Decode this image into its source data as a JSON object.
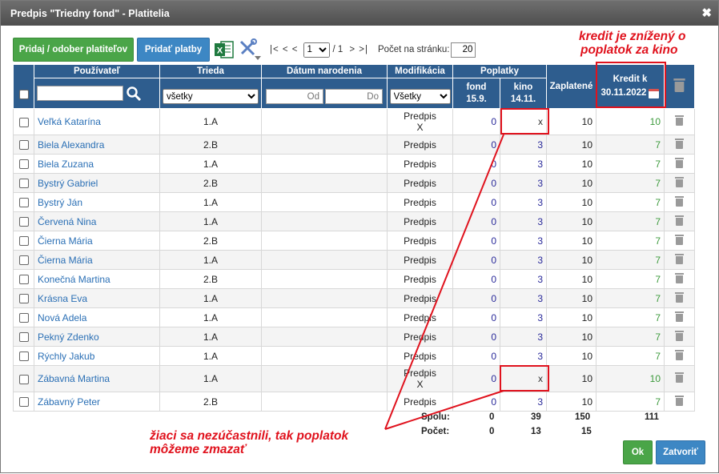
{
  "dialog": {
    "title": "Predpis \"Triedny fond\" - Platitelia",
    "close_glyph": "✖"
  },
  "toolbar": {
    "add_payers": "Pridaj / odober platiteľov",
    "add_payments": "Pridať platby",
    "excel_label": "X",
    "pager_prev": "|< < <",
    "page_current": "1",
    "page_total": "/ 1",
    "pager_next": "> >|",
    "per_page_label": "Počet na stránku:",
    "per_page_value": "20"
  },
  "headers": {
    "user": "Používateľ",
    "class": "Trieda",
    "birth": "Dátum narodenia",
    "modification": "Modifikácia",
    "fees": "Poplatky",
    "fee1_line1": "fond",
    "fee1_line2": "15.9.",
    "fee2_line1": "kino",
    "fee2_line2": "14.11.",
    "paid": "Zaplatené",
    "credit_line1": "Kredit k",
    "credit_line2": "30.11.2022"
  },
  "filters": {
    "user_value": "",
    "class_value": "všetky",
    "from_placeholder": "Od",
    "to_placeholder": "Do",
    "mod_value": "Všetky"
  },
  "rows": [
    {
      "name": "Veľká Katarína",
      "class": "1.A",
      "mod1": "Predpis",
      "mod2": "X",
      "fond": "0",
      "kino": "x",
      "paid": "10",
      "credit": "10"
    },
    {
      "name": "Biela Alexandra",
      "class": "2.B",
      "mod1": "Predpis",
      "mod2": "",
      "fond": "0",
      "kino": "3",
      "paid": "10",
      "credit": "7"
    },
    {
      "name": "Biela Zuzana",
      "class": "1.A",
      "mod1": "Predpis",
      "mod2": "",
      "fond": "0",
      "kino": "3",
      "paid": "10",
      "credit": "7"
    },
    {
      "name": "Bystrý Gabriel",
      "class": "2.B",
      "mod1": "Predpis",
      "mod2": "",
      "fond": "0",
      "kino": "3",
      "paid": "10",
      "credit": "7"
    },
    {
      "name": "Bystrý Ján",
      "class": "1.A",
      "mod1": "Predpis",
      "mod2": "",
      "fond": "0",
      "kino": "3",
      "paid": "10",
      "credit": "7"
    },
    {
      "name": "Červená Nina",
      "class": "1.A",
      "mod1": "Predpis",
      "mod2": "",
      "fond": "0",
      "kino": "3",
      "paid": "10",
      "credit": "7"
    },
    {
      "name": "Čierna Mária",
      "class": "2.B",
      "mod1": "Predpis",
      "mod2": "",
      "fond": "0",
      "kino": "3",
      "paid": "10",
      "credit": "7"
    },
    {
      "name": "Čierna Mária",
      "class": "1.A",
      "mod1": "Predpis",
      "mod2": "",
      "fond": "0",
      "kino": "3",
      "paid": "10",
      "credit": "7"
    },
    {
      "name": "Konečná Martina",
      "class": "2.B",
      "mod1": "Predpis",
      "mod2": "",
      "fond": "0",
      "kino": "3",
      "paid": "10",
      "credit": "7"
    },
    {
      "name": "Krásna Eva",
      "class": "1.A",
      "mod1": "Predpis",
      "mod2": "",
      "fond": "0",
      "kino": "3",
      "paid": "10",
      "credit": "7"
    },
    {
      "name": "Nová Adela",
      "class": "1.A",
      "mod1": "Predpis",
      "mod2": "",
      "fond": "0",
      "kino": "3",
      "paid": "10",
      "credit": "7"
    },
    {
      "name": "Pekný Zdenko",
      "class": "1.A",
      "mod1": "Predpis",
      "mod2": "",
      "fond": "0",
      "kino": "3",
      "paid": "10",
      "credit": "7"
    },
    {
      "name": "Rýchly Jakub",
      "class": "1.A",
      "mod1": "Predpis",
      "mod2": "",
      "fond": "0",
      "kino": "3",
      "paid": "10",
      "credit": "7"
    },
    {
      "name": "Zábavná Martina",
      "class": "1.A",
      "mod1": "Predpis",
      "mod2": "X",
      "fond": "0",
      "kino": "x",
      "paid": "10",
      "credit": "10"
    },
    {
      "name": "Zábavný Peter",
      "class": "2.B",
      "mod1": "Predpis",
      "mod2": "",
      "fond": "0",
      "kino": "3",
      "paid": "10",
      "credit": "7"
    }
  ],
  "summary": {
    "total_label": "Spolu:",
    "total_fond": "0",
    "total_kino": "39",
    "total_paid": "150",
    "total_credit": "111",
    "count_label": "Počet:",
    "count_fond": "0",
    "count_kino": "13",
    "count_paid": "15"
  },
  "footer": {
    "ok": "Ok",
    "close": "Zatvoriť"
  },
  "annotations": {
    "credit_note_line1": "kredit je znížený o",
    "credit_note_line2": "poplatok za kino",
    "delete_note_line1": "žiaci sa nezúčastnili, tak poplatok",
    "delete_note_line2": "môžeme zmazať"
  },
  "colors": {
    "header": "#2e5d8e",
    "green_button": "#4aa548",
    "blue_button": "#3d87c4",
    "annotation": "#e0121d"
  }
}
